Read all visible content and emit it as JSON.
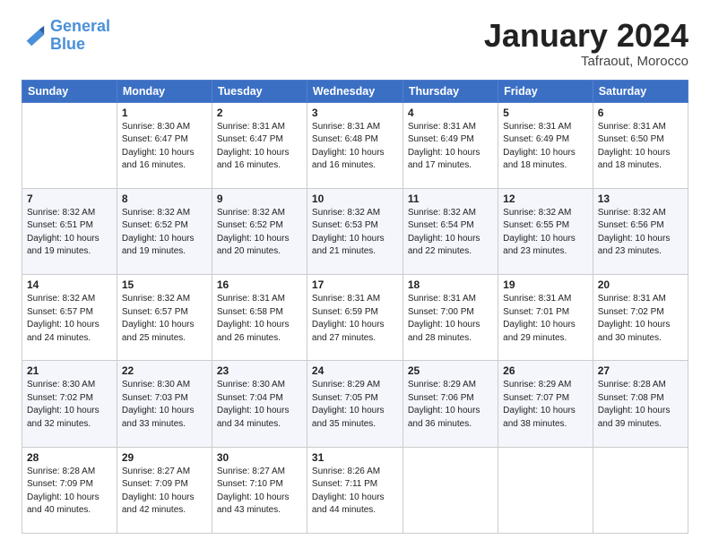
{
  "header": {
    "logo_line1": "General",
    "logo_line2": "Blue",
    "month_title": "January 2024",
    "location": "Tafraout, Morocco"
  },
  "weekdays": [
    "Sunday",
    "Monday",
    "Tuesday",
    "Wednesday",
    "Thursday",
    "Friday",
    "Saturday"
  ],
  "weeks": [
    [
      {
        "day": "",
        "info": ""
      },
      {
        "day": "1",
        "info": "Sunrise: 8:30 AM\nSunset: 6:47 PM\nDaylight: 10 hours\nand 16 minutes."
      },
      {
        "day": "2",
        "info": "Sunrise: 8:31 AM\nSunset: 6:47 PM\nDaylight: 10 hours\nand 16 minutes."
      },
      {
        "day": "3",
        "info": "Sunrise: 8:31 AM\nSunset: 6:48 PM\nDaylight: 10 hours\nand 16 minutes."
      },
      {
        "day": "4",
        "info": "Sunrise: 8:31 AM\nSunset: 6:49 PM\nDaylight: 10 hours\nand 17 minutes."
      },
      {
        "day": "5",
        "info": "Sunrise: 8:31 AM\nSunset: 6:49 PM\nDaylight: 10 hours\nand 18 minutes."
      },
      {
        "day": "6",
        "info": "Sunrise: 8:31 AM\nSunset: 6:50 PM\nDaylight: 10 hours\nand 18 minutes."
      }
    ],
    [
      {
        "day": "7",
        "info": "Sunrise: 8:32 AM\nSunset: 6:51 PM\nDaylight: 10 hours\nand 19 minutes."
      },
      {
        "day": "8",
        "info": "Sunrise: 8:32 AM\nSunset: 6:52 PM\nDaylight: 10 hours\nand 19 minutes."
      },
      {
        "day": "9",
        "info": "Sunrise: 8:32 AM\nSunset: 6:52 PM\nDaylight: 10 hours\nand 20 minutes."
      },
      {
        "day": "10",
        "info": "Sunrise: 8:32 AM\nSunset: 6:53 PM\nDaylight: 10 hours\nand 21 minutes."
      },
      {
        "day": "11",
        "info": "Sunrise: 8:32 AM\nSunset: 6:54 PM\nDaylight: 10 hours\nand 22 minutes."
      },
      {
        "day": "12",
        "info": "Sunrise: 8:32 AM\nSunset: 6:55 PM\nDaylight: 10 hours\nand 23 minutes."
      },
      {
        "day": "13",
        "info": "Sunrise: 8:32 AM\nSunset: 6:56 PM\nDaylight: 10 hours\nand 23 minutes."
      }
    ],
    [
      {
        "day": "14",
        "info": "Sunrise: 8:32 AM\nSunset: 6:57 PM\nDaylight: 10 hours\nand 24 minutes."
      },
      {
        "day": "15",
        "info": "Sunrise: 8:32 AM\nSunset: 6:57 PM\nDaylight: 10 hours\nand 25 minutes."
      },
      {
        "day": "16",
        "info": "Sunrise: 8:31 AM\nSunset: 6:58 PM\nDaylight: 10 hours\nand 26 minutes."
      },
      {
        "day": "17",
        "info": "Sunrise: 8:31 AM\nSunset: 6:59 PM\nDaylight: 10 hours\nand 27 minutes."
      },
      {
        "day": "18",
        "info": "Sunrise: 8:31 AM\nSunset: 7:00 PM\nDaylight: 10 hours\nand 28 minutes."
      },
      {
        "day": "19",
        "info": "Sunrise: 8:31 AM\nSunset: 7:01 PM\nDaylight: 10 hours\nand 29 minutes."
      },
      {
        "day": "20",
        "info": "Sunrise: 8:31 AM\nSunset: 7:02 PM\nDaylight: 10 hours\nand 30 minutes."
      }
    ],
    [
      {
        "day": "21",
        "info": "Sunrise: 8:30 AM\nSunset: 7:02 PM\nDaylight: 10 hours\nand 32 minutes."
      },
      {
        "day": "22",
        "info": "Sunrise: 8:30 AM\nSunset: 7:03 PM\nDaylight: 10 hours\nand 33 minutes."
      },
      {
        "day": "23",
        "info": "Sunrise: 8:30 AM\nSunset: 7:04 PM\nDaylight: 10 hours\nand 34 minutes."
      },
      {
        "day": "24",
        "info": "Sunrise: 8:29 AM\nSunset: 7:05 PM\nDaylight: 10 hours\nand 35 minutes."
      },
      {
        "day": "25",
        "info": "Sunrise: 8:29 AM\nSunset: 7:06 PM\nDaylight: 10 hours\nand 36 minutes."
      },
      {
        "day": "26",
        "info": "Sunrise: 8:29 AM\nSunset: 7:07 PM\nDaylight: 10 hours\nand 38 minutes."
      },
      {
        "day": "27",
        "info": "Sunrise: 8:28 AM\nSunset: 7:08 PM\nDaylight: 10 hours\nand 39 minutes."
      }
    ],
    [
      {
        "day": "28",
        "info": "Sunrise: 8:28 AM\nSunset: 7:09 PM\nDaylight: 10 hours\nand 40 minutes."
      },
      {
        "day": "29",
        "info": "Sunrise: 8:27 AM\nSunset: 7:09 PM\nDaylight: 10 hours\nand 42 minutes."
      },
      {
        "day": "30",
        "info": "Sunrise: 8:27 AM\nSunset: 7:10 PM\nDaylight: 10 hours\nand 43 minutes."
      },
      {
        "day": "31",
        "info": "Sunrise: 8:26 AM\nSunset: 7:11 PM\nDaylight: 10 hours\nand 44 minutes."
      },
      {
        "day": "",
        "info": ""
      },
      {
        "day": "",
        "info": ""
      },
      {
        "day": "",
        "info": ""
      }
    ]
  ]
}
